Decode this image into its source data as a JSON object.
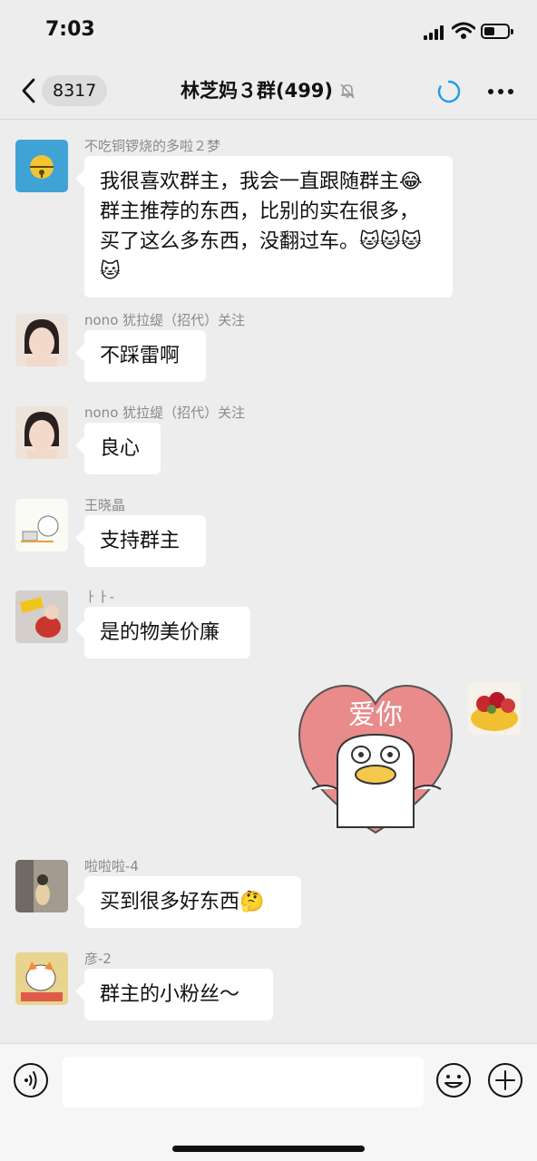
{
  "status_bar": {
    "time": "7:03"
  },
  "nav": {
    "unread_count": "8317",
    "title": "林芝妈３群(499)"
  },
  "messages": [
    {
      "sender": "不吃铜锣烧的多啦２梦",
      "text": "我很喜欢群主，我会一直跟随群主😂群主推荐的东西，比别的实在很多，买了这么多东西，没翻过车。🐱🐱🐱🐱"
    },
    {
      "sender": "nono 犹拉缇（招代）关注",
      "text": "不踩雷啊"
    },
    {
      "sender": "nono 犹拉缇（招代）关注",
      "text": "良心"
    },
    {
      "sender": "王晓晶",
      "text": "支持群主"
    },
    {
      "sender": "ㅏㅏ-",
      "text": "是的物美价廉"
    },
    {
      "sender": "啦啦啦-4",
      "text": "买到很多好东西🤔"
    },
    {
      "sender": "彦-2",
      "text": "群主的小粉丝～"
    }
  ],
  "sticker": {
    "text": "爱你"
  },
  "input": {
    "placeholder": ""
  },
  "colors": {
    "background": "#ededed",
    "bubble": "#ffffff",
    "accent": "#1e9de9",
    "sticker_heart": "#e98b8b"
  }
}
